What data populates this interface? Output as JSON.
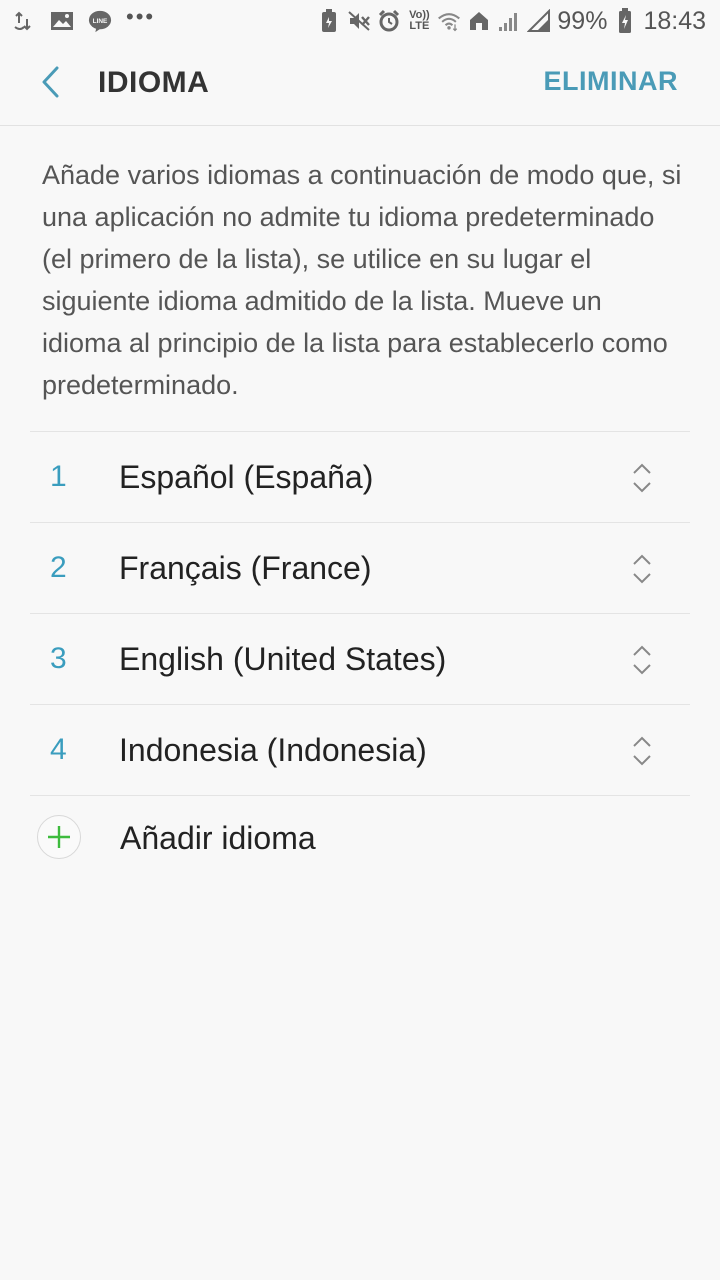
{
  "status_bar": {
    "battery_percent": "99%",
    "time": "18:43",
    "volte_top": "Vo))",
    "volte_bottom": "LTE",
    "more_indicator": "•••",
    "icons": [
      "data-transfer-icon",
      "image-icon",
      "line-app-icon",
      "battery-saver-icon",
      "mute-icon",
      "alarm-icon",
      "volte-icon",
      "wifi-icon",
      "home-icon",
      "signal-icon",
      "signal-no-sim-icon",
      "battery-charging-icon"
    ]
  },
  "app_bar": {
    "title": "IDIOMA",
    "action_label": "ELIMINAR",
    "back_icon": "chevron-left-icon"
  },
  "description": "Añade varios idiomas a continuación de modo que, si una aplicación no admite tu idioma predeterminado (el primero de la lista), se utilice en su lugar el siguiente idioma admitido de la lista. Mueve un idioma al principio de la lista para establecerlo como predeterminado.",
  "languages": [
    {
      "index": "1",
      "name": "Español (España)"
    },
    {
      "index": "2",
      "name": "Français (France)"
    },
    {
      "index": "3",
      "name": "English (United States)"
    },
    {
      "index": "4",
      "name": "Indonesia (Indonesia)"
    }
  ],
  "add_language": {
    "label": "Añadir idioma",
    "icon": "plus-icon"
  },
  "colors": {
    "accent": "#4a9bb7",
    "number": "#3a9dbe",
    "add_plus": "#3dbb3d",
    "background": "#f8f8f8"
  }
}
